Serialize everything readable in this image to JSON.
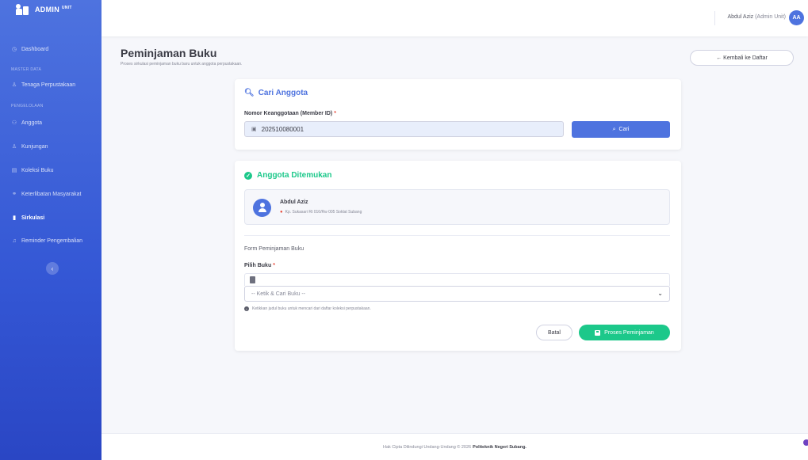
{
  "sidebar": {
    "brand": "ADMIN",
    "brand_sup": "UNIT",
    "items": [
      {
        "label": "Dashboard",
        "icon": "gauge-icon"
      },
      {
        "label": "Tenaga Perpustakaan",
        "icon": "user-tie-icon"
      },
      {
        "label": "Anggota",
        "icon": "users-icon"
      },
      {
        "label": "Kunjungan",
        "icon": "walking-icon"
      },
      {
        "label": "Koleksi Buku",
        "icon": "book-icon"
      },
      {
        "label": "Keterlibatan Masyarakat",
        "icon": "handshake-icon"
      },
      {
        "label": "Sirkulasi",
        "icon": "book-open-icon"
      },
      {
        "label": "Reminder Pengembalian",
        "icon": "bell-icon"
      }
    ],
    "headings": [
      "MASTER DATA",
      "PENGELOLAAN"
    ]
  },
  "topbar": {
    "user_name": "Abdul Aziz",
    "user_role": "(Admin Unit)",
    "avatar_initials": "AA"
  },
  "page": {
    "title": "Peminjaman Buku",
    "subtitle": "Proses sirkulasi peminjaman buku baru untuk anggota perpustakaan.",
    "back_label": "← Kembali ke Daftar"
  },
  "search_card": {
    "title": "Cari Anggota",
    "field_label": "Nomor Keanggotaan (Member ID)",
    "field_value": "202510080001",
    "search_label": "Cari"
  },
  "result_card": {
    "title": "Anggota Ditemukan",
    "member_name": "Abdul Aziz",
    "member_address": "Kp. Sukasari Rt 016/Rw 005 Soklat Subang",
    "form_title": "Form Peminjaman Buku",
    "book_label": "Pilih Buku",
    "book_placeholder": "-- Ketik & Cari Buku --",
    "hint": "Ketikkan judul buku untuk mencari dari daftar koleksi perpustakaan.",
    "cancel_label": "Batal",
    "submit_label": "Proses Peminjaman"
  },
  "footer": {
    "text": "Hak Cipta Dilindungi Undang-Undang © 2026",
    "org": "Politeknik Negeri Subang."
  },
  "colors": {
    "primary": "#4e73df",
    "success": "#1cc88a",
    "danger": "#e74a3b"
  }
}
